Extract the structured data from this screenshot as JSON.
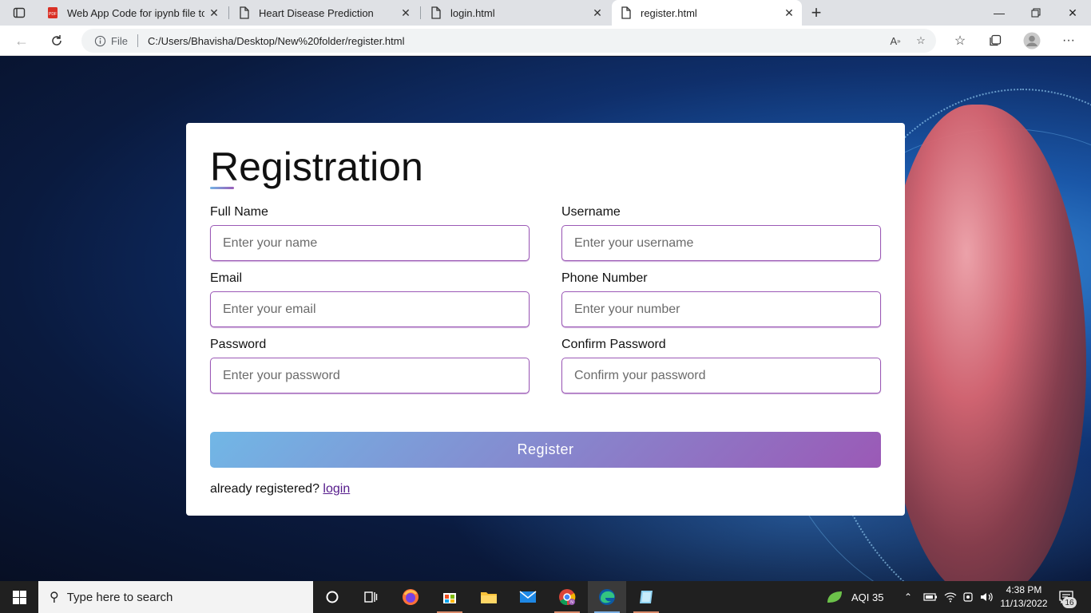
{
  "browser": {
    "tabs": [
      {
        "title": "Web App Code for ipynb file to f",
        "icon": "pdf-icon"
      },
      {
        "title": "Heart Disease Prediction",
        "icon": "page-icon"
      },
      {
        "title": "login.html",
        "icon": "page-icon"
      },
      {
        "title": "register.html",
        "icon": "page-icon"
      }
    ],
    "active_tab": 3,
    "address": {
      "security_label": "File",
      "url": "C:/Users/Bhavisha/Desktop/New%20folder/register.html"
    }
  },
  "page": {
    "title": "Registration",
    "fields": {
      "full_name": {
        "label": "Full Name",
        "placeholder": "Enter your name",
        "value": ""
      },
      "username": {
        "label": "Username",
        "placeholder": "Enter your username",
        "value": ""
      },
      "email": {
        "label": "Email",
        "placeholder": "Enter your email",
        "value": ""
      },
      "phone": {
        "label": "Phone Number",
        "placeholder": "Enter your number",
        "value": ""
      },
      "password": {
        "label": "Password",
        "placeholder": "Enter your password",
        "value": ""
      },
      "confirm_password": {
        "label": "Confirm Password",
        "placeholder": "Confirm your password",
        "value": ""
      }
    },
    "register_label": "Register",
    "already_text": "already registered?",
    "login_link": "login",
    "colors": {
      "gradient_start": "#71b7e6",
      "gradient_end": "#9b59b6",
      "input_border": "#9b59b6"
    }
  },
  "taskbar": {
    "search_placeholder": "Type here to search",
    "aqi": "AQI 35",
    "time": "4:38 PM",
    "date": "11/13/2022",
    "notification_count": "16"
  }
}
